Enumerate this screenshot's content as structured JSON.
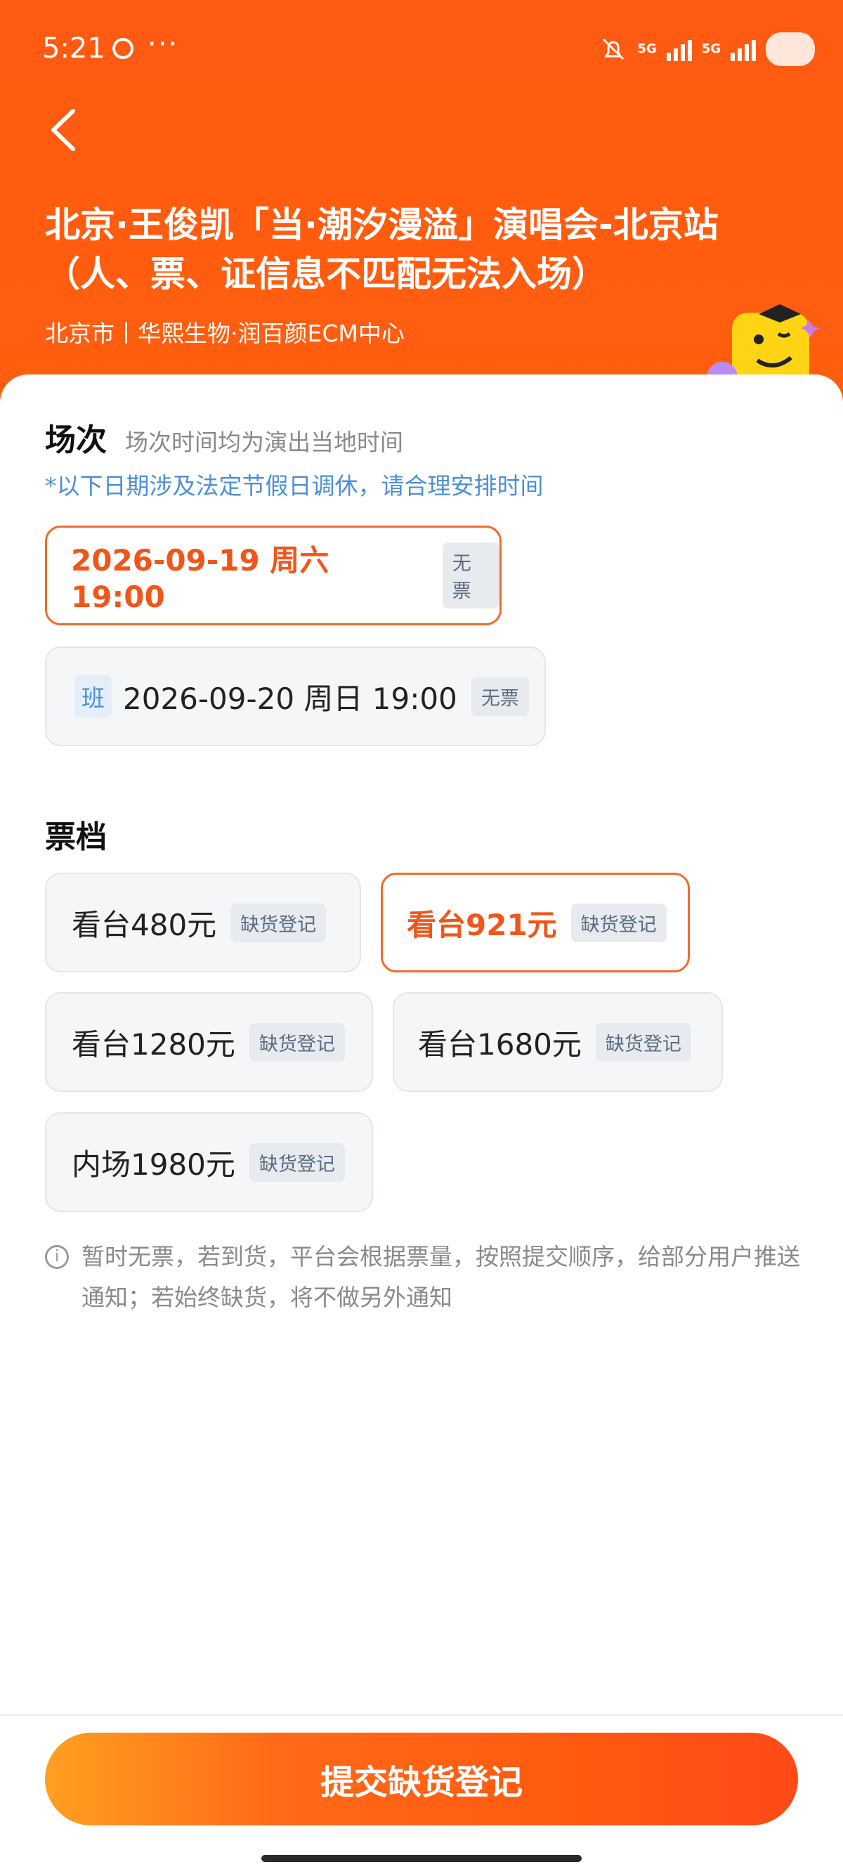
{
  "status": {
    "time": "5:21",
    "dots": "···",
    "net1": "5G",
    "net2": "5G"
  },
  "event": {
    "title": "北京·王俊凯「当·潮汐漫溢」演唱会-北京站（人、票、证信息不匹配无法入场）",
    "venue": "北京市丨华熙生物·润百颜ECM中心"
  },
  "session": {
    "title": "场次",
    "subtitle": "场次时间均为演出当地时间",
    "holiday_note": "*以下日期涉及法定节假日调休，请合理安排时间",
    "options": [
      {
        "label": "2026-09-19  周六 19:00",
        "tag": "无票",
        "selected": true
      },
      {
        "badge": "班",
        "label": "2026-09-20 周日 19:00",
        "tag": "无票",
        "selected": false
      }
    ]
  },
  "tiers": {
    "title": "票档",
    "options": [
      {
        "label": "看台480元",
        "tag": "缺货登记",
        "selected": false
      },
      {
        "label": "看台921元",
        "tag": "缺货登记",
        "selected": true
      },
      {
        "label": "看台1280元",
        "tag": "缺货登记",
        "selected": false
      },
      {
        "label": "看台1680元",
        "tag": "缺货登记",
        "selected": false
      },
      {
        "label": "内场1980元",
        "tag": "缺货登记",
        "selected": false
      }
    ]
  },
  "notice": "暂时无票，若到货，平台会根据票量，按照提交顺序，给部分用户推送通知；若始终缺货，将不做另外通知",
  "submit_label": "提交缺货登记",
  "colors": {
    "brand": "#ff5a12",
    "selected": "#f0561a",
    "link": "#4e8fd8"
  }
}
